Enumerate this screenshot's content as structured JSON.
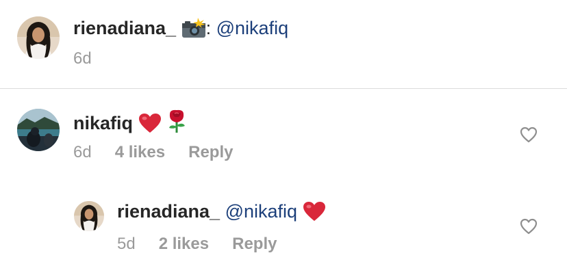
{
  "caption": {
    "username": "rienadiana_",
    "icon": "camera-flash-emoji",
    "separator": ":",
    "mention": "@nikafiq",
    "time": "6d"
  },
  "comments": [
    {
      "username": "nikafiq",
      "emojis": [
        "red-heart-emoji",
        "rose-emoji"
      ],
      "time": "6d",
      "likes": "4 likes",
      "reply_label": "Reply",
      "like_icon": "heart-outline-icon"
    },
    {
      "username": "rienadiana_",
      "mention": "@nikafiq",
      "emojis": [
        "red-heart-emoji"
      ],
      "time": "5d",
      "likes": "2 likes",
      "reply_label": "Reply",
      "like_icon": "heart-outline-icon"
    }
  ],
  "colors": {
    "username": "#262626",
    "mention": "#1c3f7a",
    "meta": "#9a9a9a",
    "divider": "#dbdbdb",
    "heart": "#e0233d"
  }
}
